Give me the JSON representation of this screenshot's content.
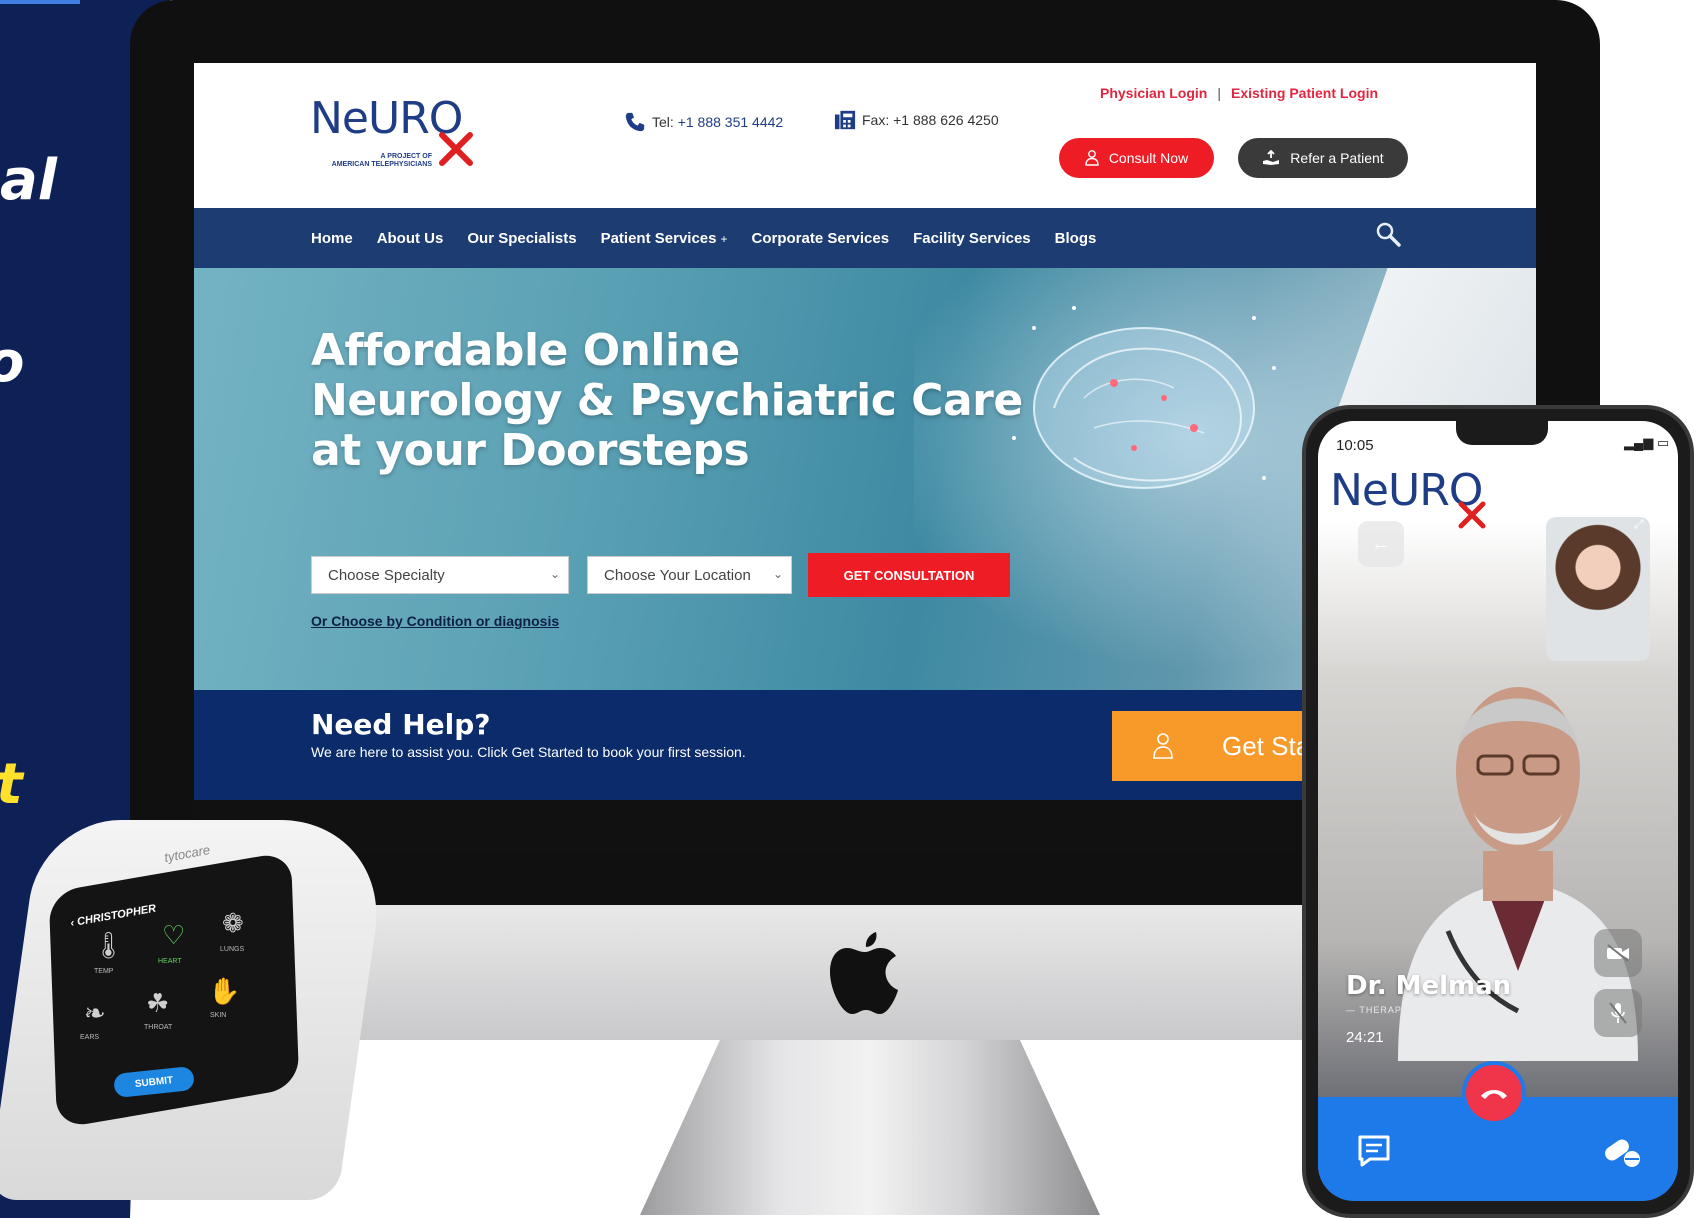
{
  "page": {
    "left_fragments": [
      "al",
      "o",
      "t"
    ]
  },
  "header": {
    "logo_text": "NeURO",
    "logo_sub_1": "A PROJECT OF",
    "logo_sub_2": "AMERICAN TELEPHYSICIANS",
    "tel_label": "Tel: ",
    "tel_number": "+1 888 351 4442",
    "fax_label": "Fax: ",
    "fax_number": "+1 888 626 4250",
    "physician_login": "Physician Login",
    "separator": "|",
    "patient_login": "Existing Patient Login",
    "consult_now": "Consult Now",
    "refer_patient": "Refer a Patient"
  },
  "nav": {
    "items": [
      "Home",
      "About Us",
      "Our Specialists",
      "Patient Services",
      "Corporate Services",
      "Facility Services",
      "Blogs"
    ],
    "patient_services_plus": "+"
  },
  "hero": {
    "title_line_1": "Affordable Online",
    "title_line_2": "Neurology & Psychiatric Care",
    "title_line_3": "at your Doorsteps",
    "specialty_placeholder": "Choose Specialty",
    "location_placeholder": "Choose Your Location",
    "get_consultation": "GET CONSULTATION",
    "condition_link": "Or Choose by Condition or diagnosis"
  },
  "help": {
    "title": "Need Help?",
    "text": "We are here to assist you. Click Get Started to book your first session.",
    "get_started": "Get Sta"
  },
  "phone": {
    "time": "10:05",
    "logo_text": "NeURO",
    "doctor_name": "Dr. Melman",
    "doctor_role": "— THERAPIST",
    "call_timer": "24:21"
  },
  "tytocare": {
    "brand": "tytocare",
    "user": "‹ CHRISTOPHER",
    "labels": [
      "TEMP",
      "HEART",
      "LUNGS",
      "EARS",
      "THROAT",
      "SKIN"
    ],
    "submit": "SUBMIT"
  },
  "colors": {
    "brand_navy": "#1f3d86",
    "nav_bg": "#1c3c72",
    "help_bg": "#0b2b6b",
    "accent_red": "#ee1c25",
    "accent_orange": "#f79a2a",
    "call_blue": "#1e7ae8"
  }
}
